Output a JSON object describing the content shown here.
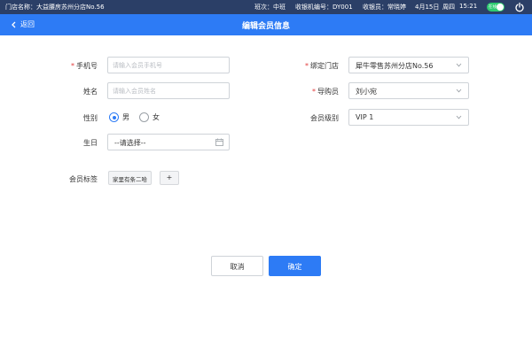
{
  "status_bar": {
    "store": "门店名称：大益腰房苏州分店No.56",
    "shift": "班次：中班",
    "register": "收银机编号：DY001",
    "cashier": "收银员：常晓婷",
    "date": "4月15日",
    "weekday": "周四",
    "time": "15:21",
    "toggle_label": "在线"
  },
  "header": {
    "back_label": "返回",
    "title": "编辑会员信息"
  },
  "form": {
    "required_mark": "*",
    "phone": {
      "label": "手机号",
      "value": "",
      "placeholder": "请输入会员手机号"
    },
    "name": {
      "label": "姓名",
      "value": "",
      "placeholder": "请输入会员姓名"
    },
    "gender": {
      "label": "性别",
      "options": [
        "男",
        "女"
      ],
      "selected": "男"
    },
    "birthday": {
      "label": "生日",
      "value": "--请选择--"
    },
    "store": {
      "label": "绑定门店",
      "value": "犀牛零售苏州分店No.56"
    },
    "guide": {
      "label": "导购员",
      "value": "刘小宛"
    },
    "level": {
      "label": "会员级别",
      "value": "VIP 1"
    },
    "tags": {
      "label": "会员标签",
      "items": [
        "家里有条二哈"
      ],
      "add_label": "+"
    }
  },
  "actions": {
    "cancel_label": "取消",
    "confirm_label": "确定"
  },
  "colors": {
    "primary": "#2d7bf5",
    "status_bar": "#2b3f67",
    "required": "#e23b3b",
    "online": "#2ecc71"
  }
}
